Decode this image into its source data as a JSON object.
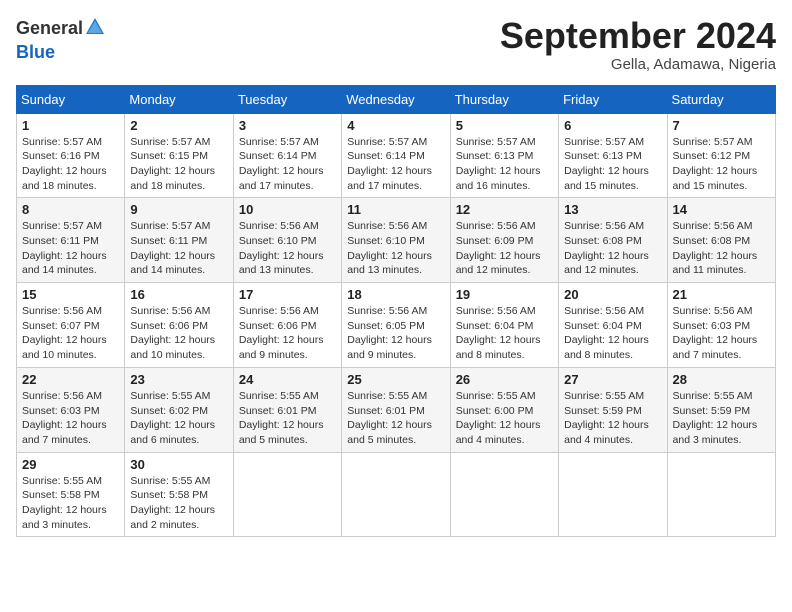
{
  "header": {
    "logo_line1": "General",
    "logo_line2": "Blue",
    "month": "September 2024",
    "location": "Gella, Adamawa, Nigeria"
  },
  "weekdays": [
    "Sunday",
    "Monday",
    "Tuesday",
    "Wednesday",
    "Thursday",
    "Friday",
    "Saturday"
  ],
  "weeks": [
    [
      {
        "day": "1",
        "sunrise": "5:57 AM",
        "sunset": "6:16 PM",
        "daylight": "12 hours and 18 minutes."
      },
      {
        "day": "2",
        "sunrise": "5:57 AM",
        "sunset": "6:15 PM",
        "daylight": "12 hours and 18 minutes."
      },
      {
        "day": "3",
        "sunrise": "5:57 AM",
        "sunset": "6:14 PM",
        "daylight": "12 hours and 17 minutes."
      },
      {
        "day": "4",
        "sunrise": "5:57 AM",
        "sunset": "6:14 PM",
        "daylight": "12 hours and 17 minutes."
      },
      {
        "day": "5",
        "sunrise": "5:57 AM",
        "sunset": "6:13 PM",
        "daylight": "12 hours and 16 minutes."
      },
      {
        "day": "6",
        "sunrise": "5:57 AM",
        "sunset": "6:13 PM",
        "daylight": "12 hours and 15 minutes."
      },
      {
        "day": "7",
        "sunrise": "5:57 AM",
        "sunset": "6:12 PM",
        "daylight": "12 hours and 15 minutes."
      }
    ],
    [
      {
        "day": "8",
        "sunrise": "5:57 AM",
        "sunset": "6:11 PM",
        "daylight": "12 hours and 14 minutes."
      },
      {
        "day": "9",
        "sunrise": "5:57 AM",
        "sunset": "6:11 PM",
        "daylight": "12 hours and 14 minutes."
      },
      {
        "day": "10",
        "sunrise": "5:56 AM",
        "sunset": "6:10 PM",
        "daylight": "12 hours and 13 minutes."
      },
      {
        "day": "11",
        "sunrise": "5:56 AM",
        "sunset": "6:10 PM",
        "daylight": "12 hours and 13 minutes."
      },
      {
        "day": "12",
        "sunrise": "5:56 AM",
        "sunset": "6:09 PM",
        "daylight": "12 hours and 12 minutes."
      },
      {
        "day": "13",
        "sunrise": "5:56 AM",
        "sunset": "6:08 PM",
        "daylight": "12 hours and 12 minutes."
      },
      {
        "day": "14",
        "sunrise": "5:56 AM",
        "sunset": "6:08 PM",
        "daylight": "12 hours and 11 minutes."
      }
    ],
    [
      {
        "day": "15",
        "sunrise": "5:56 AM",
        "sunset": "6:07 PM",
        "daylight": "12 hours and 10 minutes."
      },
      {
        "day": "16",
        "sunrise": "5:56 AM",
        "sunset": "6:06 PM",
        "daylight": "12 hours and 10 minutes."
      },
      {
        "day": "17",
        "sunrise": "5:56 AM",
        "sunset": "6:06 PM",
        "daylight": "12 hours and 9 minutes."
      },
      {
        "day": "18",
        "sunrise": "5:56 AM",
        "sunset": "6:05 PM",
        "daylight": "12 hours and 9 minutes."
      },
      {
        "day": "19",
        "sunrise": "5:56 AM",
        "sunset": "6:04 PM",
        "daylight": "12 hours and 8 minutes."
      },
      {
        "day": "20",
        "sunrise": "5:56 AM",
        "sunset": "6:04 PM",
        "daylight": "12 hours and 8 minutes."
      },
      {
        "day": "21",
        "sunrise": "5:56 AM",
        "sunset": "6:03 PM",
        "daylight": "12 hours and 7 minutes."
      }
    ],
    [
      {
        "day": "22",
        "sunrise": "5:56 AM",
        "sunset": "6:03 PM",
        "daylight": "12 hours and 7 minutes."
      },
      {
        "day": "23",
        "sunrise": "5:55 AM",
        "sunset": "6:02 PM",
        "daylight": "12 hours and 6 minutes."
      },
      {
        "day": "24",
        "sunrise": "5:55 AM",
        "sunset": "6:01 PM",
        "daylight": "12 hours and 5 minutes."
      },
      {
        "day": "25",
        "sunrise": "5:55 AM",
        "sunset": "6:01 PM",
        "daylight": "12 hours and 5 minutes."
      },
      {
        "day": "26",
        "sunrise": "5:55 AM",
        "sunset": "6:00 PM",
        "daylight": "12 hours and 4 minutes."
      },
      {
        "day": "27",
        "sunrise": "5:55 AM",
        "sunset": "5:59 PM",
        "daylight": "12 hours and 4 minutes."
      },
      {
        "day": "28",
        "sunrise": "5:55 AM",
        "sunset": "5:59 PM",
        "daylight": "12 hours and 3 minutes."
      }
    ],
    [
      {
        "day": "29",
        "sunrise": "5:55 AM",
        "sunset": "5:58 PM",
        "daylight": "12 hours and 3 minutes."
      },
      {
        "day": "30",
        "sunrise": "5:55 AM",
        "sunset": "5:58 PM",
        "daylight": "12 hours and 2 minutes."
      },
      null,
      null,
      null,
      null,
      null
    ]
  ]
}
